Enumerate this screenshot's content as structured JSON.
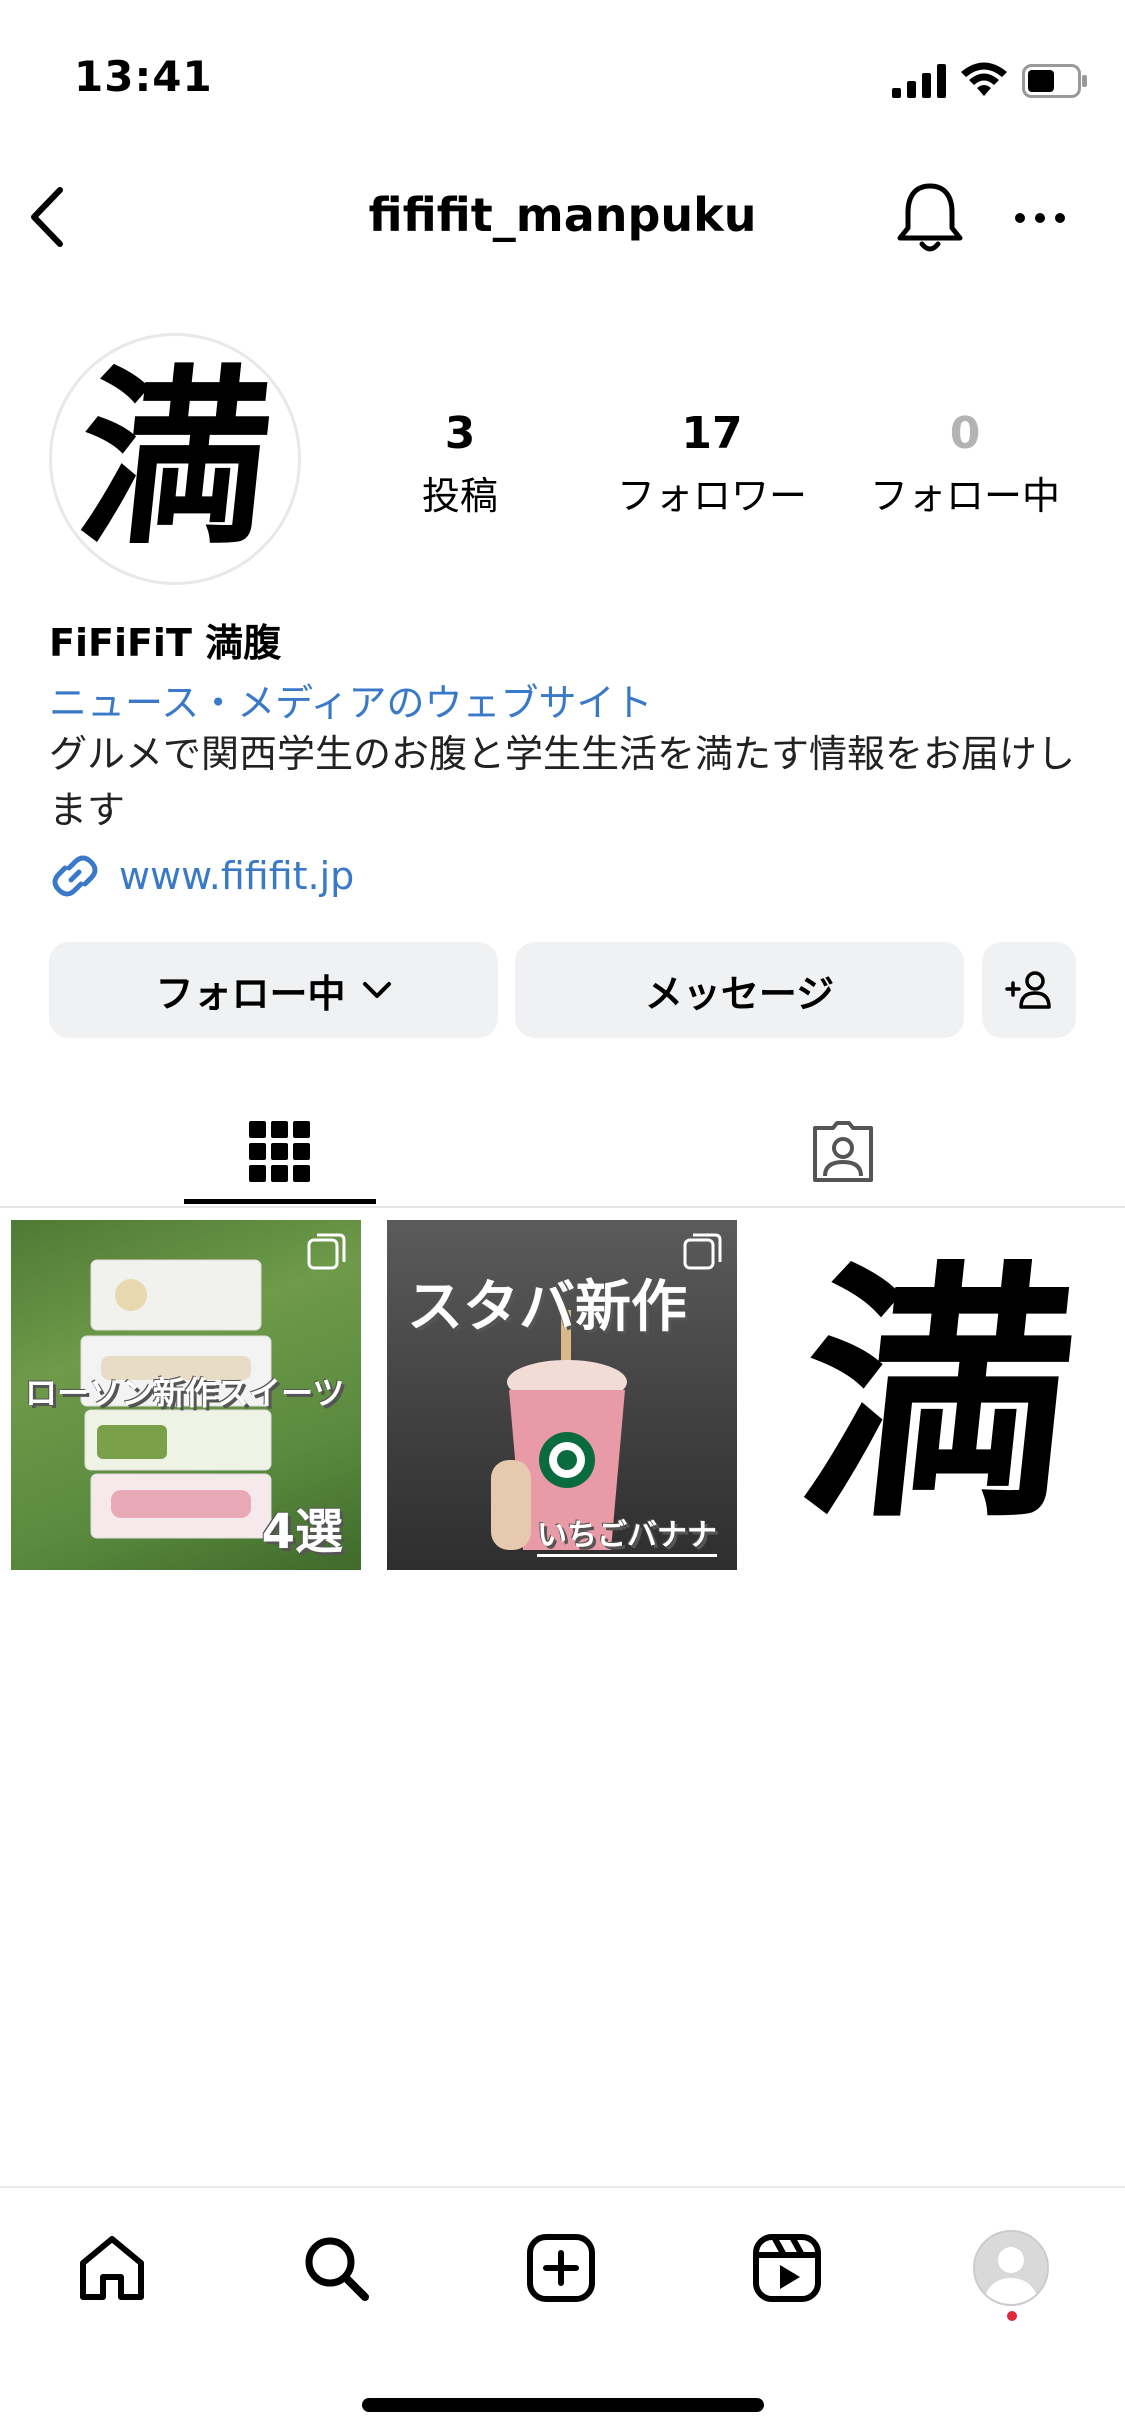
{
  "status_bar": {
    "time": "13:41"
  },
  "header": {
    "username": "fififit_manpuku"
  },
  "profile": {
    "avatar_glyph": "満",
    "stats": [
      {
        "value": "3",
        "label": "投稿"
      },
      {
        "value": "17",
        "label": "フォロワー"
      },
      {
        "value": "0",
        "label": "フォロー中"
      }
    ],
    "display_name": "FiFiFiT 満腹",
    "category": "ニュース・メディアのウェブサイト",
    "bio": "グルメで関西学生のお腹と学生生活を満たす情報をお届けします",
    "link": "www.fififit.jp"
  },
  "buttons": {
    "follow": "フォロー中",
    "message": "メッセージ"
  },
  "posts": [
    {
      "title": "ローソン新作スイーツ",
      "subtitle": "4選"
    },
    {
      "title": "スタバ新作",
      "subtitle": "いちごバナナ"
    },
    {
      "glyph": "満"
    }
  ],
  "colors": {
    "link": "#3a79c8",
    "button_bg": "#eff1f3",
    "notification_dot": "#e0283c"
  }
}
